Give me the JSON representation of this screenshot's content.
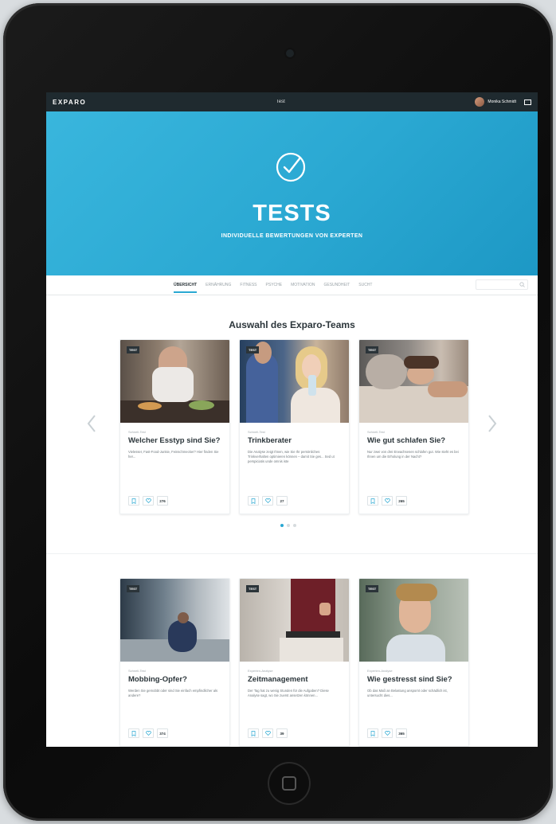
{
  "topbar": {
    "logo": "EXPARO",
    "center": "Test",
    "user_name": "Monika Schmidt"
  },
  "hero": {
    "title": "TESTS",
    "subtitle": "INDIVIDUELLE BEWERTUNGEN VON EXPERTEN"
  },
  "nav": {
    "items": [
      "ÜBERSICHT",
      "ERNÄHRUNG",
      "FITNESS",
      "PSYCHE",
      "MOTIVATION",
      "GESUNDHEIT",
      "SUCHT"
    ],
    "active": "ÜBERSICHT"
  },
  "section": {
    "title": "Auswahl des Exparo-Teams"
  },
  "featured_cards": [
    {
      "badge": "TEST",
      "category": "Schnell-Test",
      "title": "Welcher Esstyp sind Sie?",
      "desc": "Vielesser, Fast-Food-Junkie, Feinschmecker? Hier finden Sie her...",
      "likes": "276"
    },
    {
      "badge": "TEST",
      "category": "Schnell-Test",
      "title": "Trinkberater",
      "desc": "Die Analyse zeigt Ihnen, wie Sie Ihr persönliches Trinkverhalten optimieren können – damit Sie ges... Sed ut perspiciatis unde omnis iste",
      "likes": "27"
    },
    {
      "badge": "TEST",
      "category": "Schnell-Test",
      "title": "Wie gut schlafen Sie?",
      "desc": "Nur zwei von drei Erwachsenen schlafen gut. Wie steht es bei Ihnen um die Erholung in der Nacht?",
      "likes": "265"
    }
  ],
  "other_cards": [
    {
      "badge": "TEST",
      "category": "Schnell-Test",
      "title": "Mobbing-Opfer?",
      "desc": "Werden Sie gemobbt oder sind Sie einfach empfindlicher als andere?",
      "likes": "374"
    },
    {
      "badge": "TEST",
      "category": "Experten-Analyse",
      "title": "Zeitmanagement",
      "desc": "Der Tag hat zu wenig Stunden für die Aufgaben? Diese Analyse sagt, wo Sie zuerst ansetzen können...",
      "likes": "39"
    },
    {
      "badge": "TEST",
      "category": "Experten-Analyse",
      "title": "Wie gestresst sind Sie?",
      "desc": "Ob das Maß an Belastung anspornt oder schädlich ist, untersucht dies...",
      "likes": "365"
    }
  ],
  "colors": {
    "accent": "#2aa8d2",
    "hero": "#39b6dd",
    "topbar": "#1f2a2f",
    "text": "#2b353a"
  }
}
